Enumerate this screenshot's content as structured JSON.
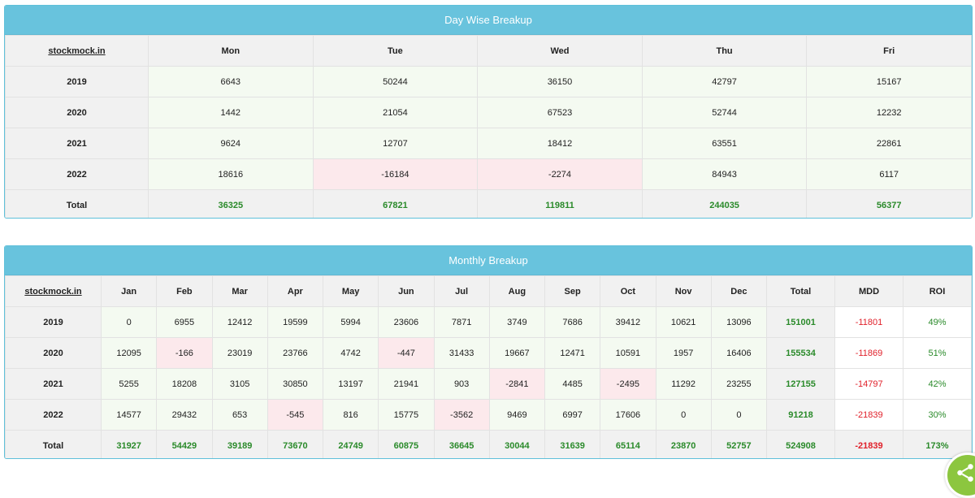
{
  "day_wise": {
    "title": "Day Wise Breakup",
    "brand": "stockmock.in",
    "columns": [
      "Mon",
      "Tue",
      "Wed",
      "Thu",
      "Fri"
    ],
    "rows": [
      {
        "label": "2019",
        "values": [
          "6643",
          "50244",
          "36150",
          "42797",
          "15167"
        ]
      },
      {
        "label": "2020",
        "values": [
          "1442",
          "21054",
          "67523",
          "52744",
          "12232"
        ]
      },
      {
        "label": "2021",
        "values": [
          "9624",
          "12707",
          "18412",
          "63551",
          "22861"
        ]
      },
      {
        "label": "2022",
        "values": [
          "18616",
          "-16184",
          "-2274",
          "84943",
          "6117"
        ]
      }
    ],
    "total": {
      "label": "Total",
      "values": [
        "36325",
        "67821",
        "119811",
        "244035",
        "56377"
      ]
    }
  },
  "monthly": {
    "title": "Monthly Breakup",
    "brand": "stockmock.in",
    "columns": [
      "Jan",
      "Feb",
      "Mar",
      "Apr",
      "May",
      "Jun",
      "Jul",
      "Aug",
      "Sep",
      "Oct",
      "Nov",
      "Dec",
      "Total",
      "MDD",
      "ROI"
    ],
    "rows": [
      {
        "label": "2019",
        "values": [
          "0",
          "6955",
          "12412",
          "19599",
          "5994",
          "23606",
          "7871",
          "3749",
          "7686",
          "39412",
          "10621",
          "13096",
          "151001",
          "-11801",
          "49%"
        ]
      },
      {
        "label": "2020",
        "values": [
          "12095",
          "-166",
          "23019",
          "23766",
          "4742",
          "-447",
          "31433",
          "19667",
          "12471",
          "10591",
          "1957",
          "16406",
          "155534",
          "-11869",
          "51%"
        ]
      },
      {
        "label": "2021",
        "values": [
          "5255",
          "18208",
          "3105",
          "30850",
          "13197",
          "21941",
          "903",
          "-2841",
          "4485",
          "-2495",
          "11292",
          "23255",
          "127155",
          "-14797",
          "42%"
        ]
      },
      {
        "label": "2022",
        "values": [
          "14577",
          "29432",
          "653",
          "-545",
          "816",
          "15775",
          "-3562",
          "9469",
          "6997",
          "17606",
          "0",
          "0",
          "91218",
          "-21839",
          "30%"
        ]
      }
    ],
    "total": {
      "label": "Total",
      "values": [
        "31927",
        "54429",
        "39189",
        "73670",
        "24749",
        "60875",
        "36645",
        "30044",
        "31639",
        "65114",
        "23870",
        "52757",
        "524908",
        "-21839",
        "173%"
      ]
    }
  },
  "share_fab": {
    "icon": "share-icon"
  },
  "colors": {
    "header": "#68c3dd",
    "positive": "#2a8a2a",
    "negative": "#e0202a",
    "negative_bg": "#fce9ec",
    "positive_bg": "#f4faf1"
  }
}
